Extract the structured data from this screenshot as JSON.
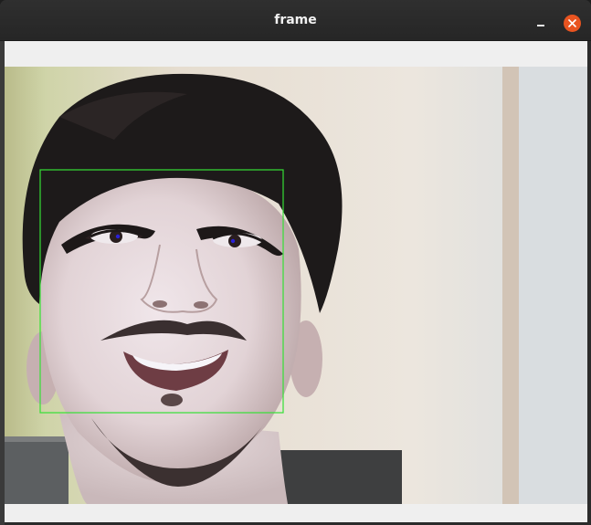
{
  "window": {
    "title": "frame",
    "minimize_icon": "minimize-icon",
    "close_icon": "close-icon",
    "close_color": "#e95420"
  },
  "frame": {
    "detection_box_color": "#35e035",
    "eye_marker_color": "#2a20d8"
  }
}
